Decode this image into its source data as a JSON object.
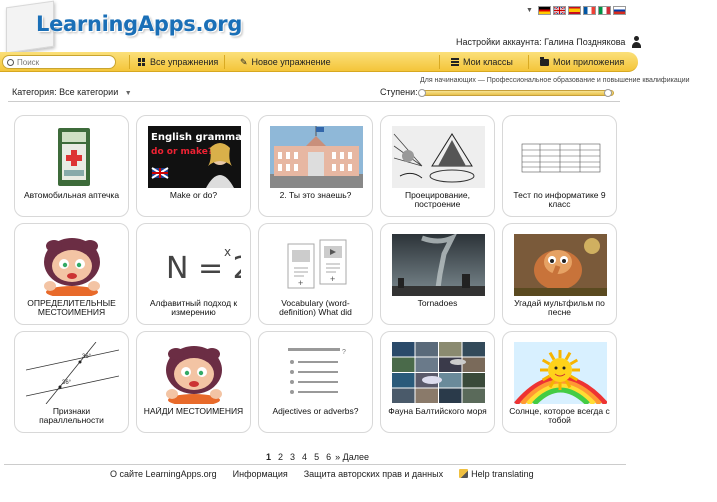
{
  "header": {
    "logo_text": "LearningApps.org",
    "account_label": "Настройки аккаунта:",
    "user_name": "Галина Позднякова",
    "flags": [
      "de",
      "en",
      "es",
      "fr",
      "it",
      "ru"
    ]
  },
  "navbar": {
    "search_placeholder": "Поиск",
    "all_exercises": "Все упражнения",
    "new_exercise": "Новое упражнение",
    "my_classes": "Мои классы",
    "my_apps": "Мои приложения"
  },
  "filters": {
    "category_label": "Категория:",
    "category_value": "Все категории",
    "levels_label": "Ступени:",
    "levels_note": "Для начинающих — Профессиональное образование и повышение квалификации"
  },
  "cards": [
    {
      "title": "Автомобильная аптечка",
      "thumb": "first-aid-kit"
    },
    {
      "title": "Make or do?",
      "thumb": "english-grammar"
    },
    {
      "title": "2. Ты это знаешь?",
      "thumb": "building"
    },
    {
      "title": "Проецирование, построение",
      "thumb": "projection-drawing"
    },
    {
      "title": "Тест по информатике 9 класс",
      "thumb": "table"
    },
    {
      "title": "ОПРЕДЕЛИТЕЛЬНЫЕ МЕСТОИМЕНИЯ",
      "thumb": "cartoon-girl"
    },
    {
      "title": "Алфавитный подход к измерению",
      "thumb": "formula"
    },
    {
      "title": "Vocabulary (word-definition) What did",
      "thumb": "vocabulary"
    },
    {
      "title": "Tornadoes",
      "thumb": "tornado"
    },
    {
      "title": "Угадай мультфильм по песне",
      "thumb": "mammoth"
    },
    {
      "title": "Признаки параллельности",
      "thumb": "parallel-lines"
    },
    {
      "title": "НАЙДИ МЕСТОИМЕНИЯ",
      "thumb": "cartoon-girl"
    },
    {
      "title": "Adjectives or adverbs?",
      "thumb": "lines-list"
    },
    {
      "title": "Фауна Балтийского моря",
      "thumb": "fauna-collage"
    },
    {
      "title": "Солнце, которое всегда с тобой",
      "thumb": "sun"
    }
  ],
  "thumb_text": {
    "grammar_line1": "English grammar",
    "grammar_line2": "do or make?",
    "formula": "N = 2"
  },
  "pagination": {
    "pages": [
      "1",
      "2",
      "3",
      "4",
      "5",
      "6"
    ],
    "current": "1",
    "next": "» Далее"
  },
  "footer": {
    "about": "О сайте LearningApps.org",
    "info": "Информация",
    "copyright": "Защита авторских прав и данных",
    "help": "Help translating"
  },
  "colors": {
    "accent_yellow": "#f4c53a",
    "logo_blue": "#1a6fb7"
  }
}
